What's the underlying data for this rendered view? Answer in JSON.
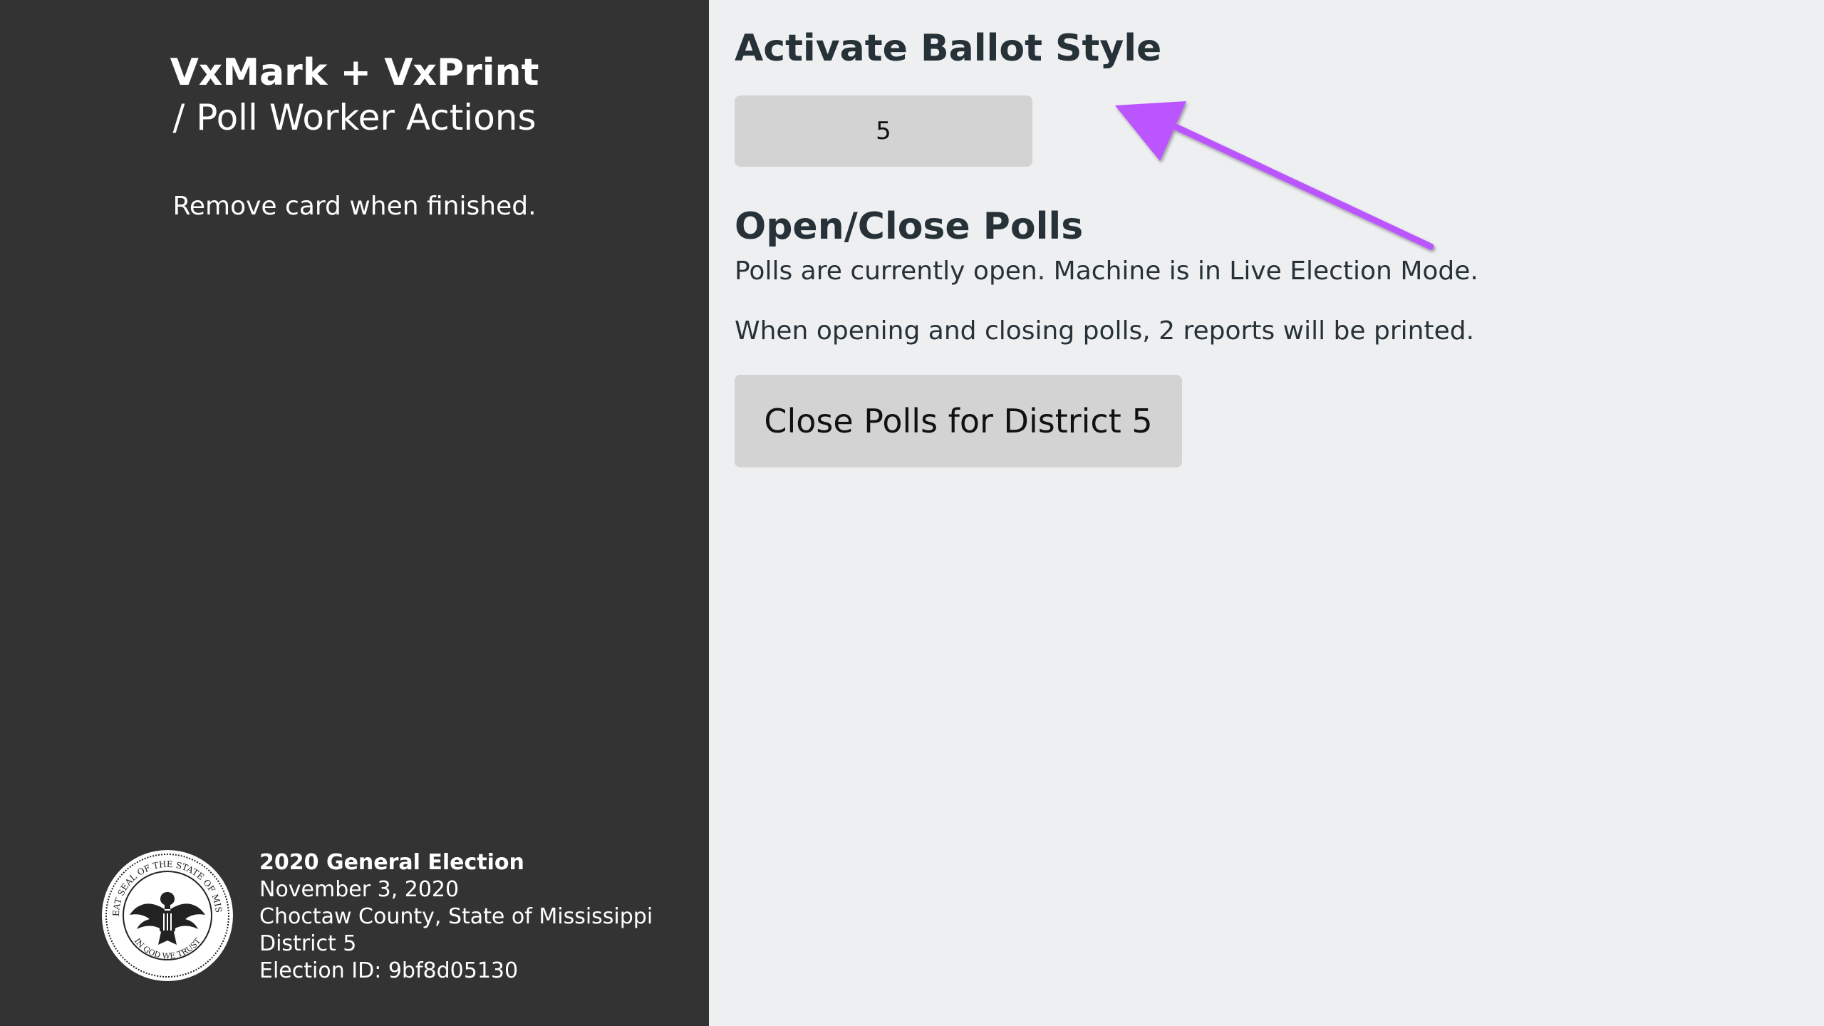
{
  "sidebar": {
    "app_name": "VxMark + VxPrint",
    "app_subtitle": "/ Poll Worker Actions",
    "instruction": "Remove card when finished.",
    "seal": {
      "icon": "state-seal-icon",
      "outer_text": "THE GREAT SEAL OF THE STATE OF MISSISSIPPI",
      "inner_text": "IN GOD WE TRUST"
    },
    "election": {
      "title": "2020 General Election",
      "date": "November 3, 2020",
      "jurisdiction": "Choctaw County, State of Mississippi",
      "district": "District 5",
      "election_id": "Election ID: 9bf8d05130"
    }
  },
  "main": {
    "activate_heading": "Activate Ballot Style",
    "ballot_style_button": "5",
    "polls_heading": "Open/Close Polls",
    "polls_status": "Polls are currently open. Machine is in Live Election Mode.",
    "reports_note": "When opening and closing polls, 2 reports will be printed.",
    "close_polls_button": "Close Polls for District 5"
  },
  "annotation": {
    "icon": "arrow-icon",
    "color": "#bb55ff"
  },
  "colors": {
    "sidebar_bg": "#333333",
    "main_bg": "#eeeff1",
    "button_bg": "#d3d3d3",
    "heading_text": "#263238"
  }
}
